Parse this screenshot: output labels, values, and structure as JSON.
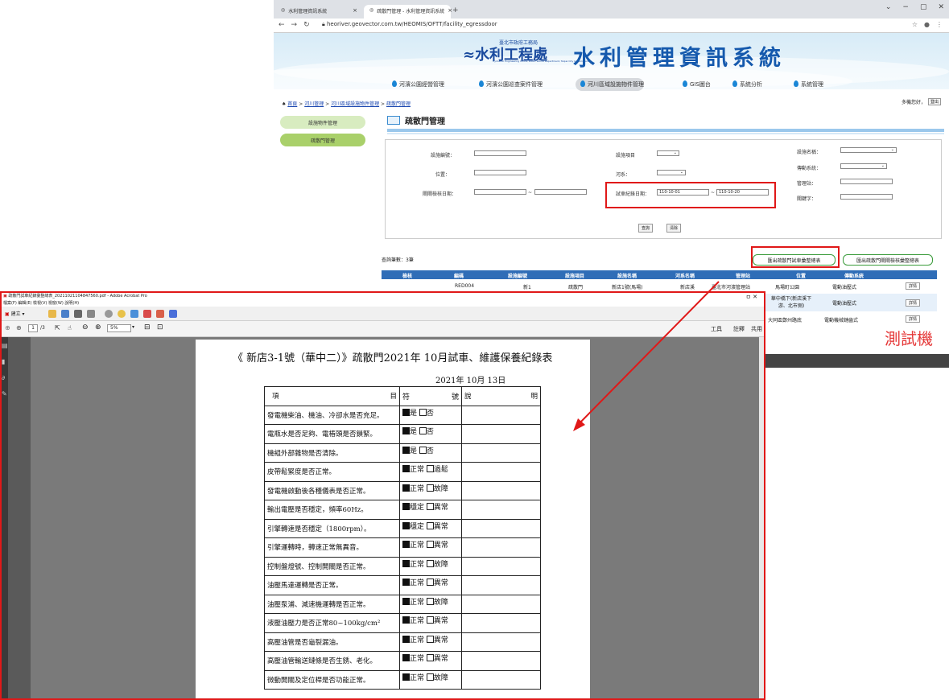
{
  "browser": {
    "tabs": [
      {
        "title": "水利管理資訊系統",
        "active": false
      },
      {
        "title": "疏散門管理 - 水利管理資訊系統",
        "active": true
      }
    ],
    "url": "heoriver.geovector.com.tw/HEOMIS/OFTT/facility_egressdoor"
  },
  "site": {
    "logo_top": "臺北市政府工務局",
    "logo_name": "水利工程處",
    "logo_en": "Hydraulic Engineering Office, Public Works Department, Taipei City Government",
    "title": "水利管理資訊系統",
    "menu": [
      "河濱公園經營管理",
      "河濱公園巡查案件管理",
      "河川區域設施物件管理",
      "GIS圖台",
      "系統分析",
      "系統管理"
    ],
    "active_menu": 2,
    "breadcrumb": {
      "home": "首頁",
      "l1": "河川管理",
      "l2": "河川區域設施物件管理",
      "l3": "疏散門管理",
      "sep": ">"
    },
    "greeting": "多機您好，",
    "logout": "登出"
  },
  "sidebar": {
    "items": [
      "設施物件管理",
      "疏散門管理"
    ]
  },
  "page": {
    "title": "疏散門管理"
  },
  "search": {
    "labels": {
      "facility_no": "設施編號：",
      "facility_item": "設施項目",
      "facility_name": "設施名稱：",
      "location": "位置：",
      "river": "河系：",
      "drive_system": "傳動系統：",
      "manager": "管理站：",
      "inspect_date": "閘閘檢核日期：",
      "trial_date": "試車紀錄日期：",
      "keyword": "關鍵字：",
      "tilde": "~"
    },
    "trial_from": "110-10-01",
    "trial_to": "110-10-20",
    "query_btn": "查詢",
    "clear_btn": "清除"
  },
  "results": {
    "count_label": "查詢筆數：3筆",
    "export_trial": "匯出疏散門試車彙整總表",
    "export_inspect": "匯出疏散門閘閘檢核彙整總表",
    "headers": [
      "檢核",
      "編碼",
      "設施編號",
      "設施項目",
      "設施名稱",
      "河系名稱",
      "管理站",
      "位置",
      "傳動系統"
    ],
    "rows": [
      {
        "code": "RED004",
        "no": "新1",
        "item": "疏散門",
        "name": "新店1號(馬場)",
        "river": "新店溪",
        "station": "臺北市河濱管理站",
        "loc": "馬場町公園",
        "drive": "電動油壓式",
        "btn": "詳情"
      },
      {
        "code": "",
        "no": "",
        "item": "",
        "name": "",
        "river": "",
        "station": "",
        "loc": "華中橋下(新店溪下游、北市側)",
        "drive": "電動油壓式",
        "btn": "詳情"
      },
      {
        "code": "",
        "no": "",
        "item": "",
        "name": "",
        "river": "",
        "station": "",
        "loc": "大同區鄭州路底",
        "drive": "電動機械鏈齒式",
        "btn": "詳情"
      }
    ]
  },
  "watermark": "測試機",
  "acrobat": {
    "title": "疏散門試車紀錄彙整總表_20211021104847560.pdf - Adobe Acrobat Pro",
    "menu": "檔案(F)  編輯(E)  檢視(V)  視窗(W)  說明(H)",
    "create": "建立",
    "page_no": "1",
    "page_total": "/3",
    "zoom": "5%",
    "right_tools": [
      "工具",
      "註釋",
      "共用"
    ]
  },
  "document": {
    "title": "《 新店3-1號（華中二）》疏散門2021年 10月試車、維護保養紀錄表",
    "date": "2021年  10月  13日",
    "col_headers": [
      "項",
      "目",
      "符",
      "號",
      "說",
      "明"
    ],
    "items": [
      {
        "text": "發電機柴油、機油、冷卻水是否充足。",
        "a": "是",
        "b": "否"
      },
      {
        "text": "電瓶水是否足夠、電樁頭是否鎖緊。",
        "a": "是",
        "b": "否"
      },
      {
        "text": "機組外部雜物是否清除。",
        "a": "是",
        "b": "否"
      },
      {
        "text": "皮帶鬆緊度是否正常。",
        "a": "正常",
        "b": "過鬆"
      },
      {
        "text": "發電機啟動後各種儀表是否正常。",
        "a": "正常",
        "b": "故障"
      },
      {
        "text": "輸出電壓是否穩定，頻率60Hz。",
        "a": "穩定",
        "b": "異常"
      },
      {
        "text": "引擎轉速是否穩定（1800rpm）。",
        "a": "穩定",
        "b": "異常"
      },
      {
        "text": "引擎運轉時，轉速正常無異音。",
        "a": "正常",
        "b": "異常"
      },
      {
        "text": "控制盤燈號、控制開關是否正常。",
        "a": "正常",
        "b": "故障"
      },
      {
        "text": "油壓馬達運轉是否正常。",
        "a": "正常",
        "b": "異常"
      },
      {
        "text": "油壓泵浦、減速機運轉是否正常。",
        "a": "正常",
        "b": "故障"
      },
      {
        "text": "液壓油壓力是否正常80~100kg/cm²",
        "a": "正常",
        "b": "異常"
      },
      {
        "text": "高壓油管是否龜裂漏油。",
        "a": "正常",
        "b": "異常"
      },
      {
        "text": "高壓油管輸送鏈條是否生銹、老化。",
        "a": "正常",
        "b": "異常"
      },
      {
        "text": "微動開關及定位桿是否功能正常。",
        "a": "正常",
        "b": "故障"
      }
    ]
  },
  "colors": {
    "accent": "#2f6db7",
    "highlight": "#e01818",
    "site_title": "#1559ad"
  }
}
